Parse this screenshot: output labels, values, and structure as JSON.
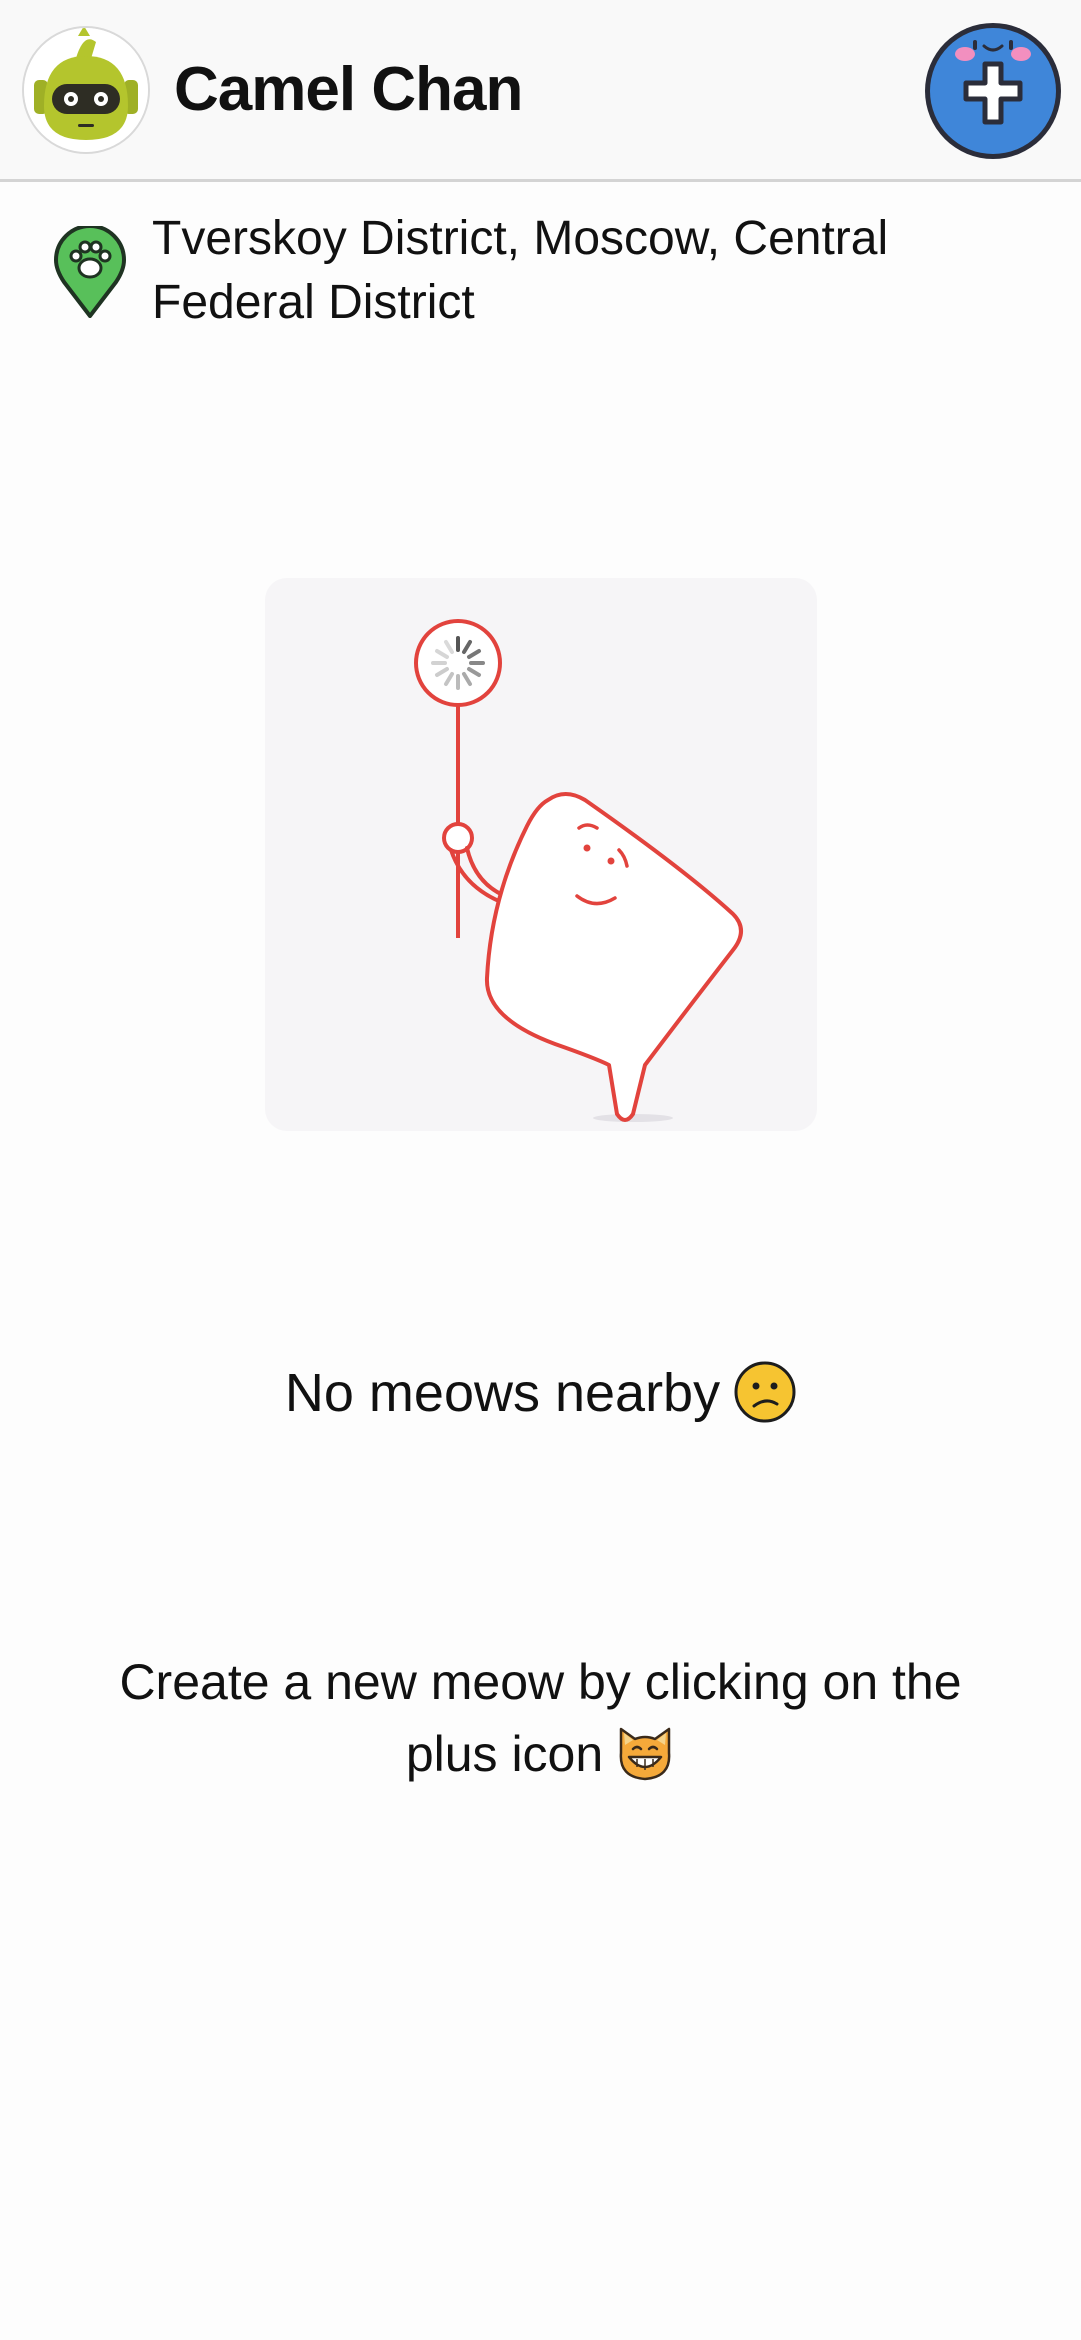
{
  "header": {
    "user_name": "Camel Chan",
    "avatar_icon": "robot-avatar-icon",
    "add_icon": "plus-icon"
  },
  "location": {
    "icon": "paw-location-pin-icon",
    "text": "Tverskoy District, Moscow, Central Federal District"
  },
  "empty_state": {
    "illustration": "loading-character-illustration",
    "title": "No meows nearby",
    "title_emoji": "confused-face-icon",
    "hint": "Create a new meow by clicking on the plus icon",
    "hint_emoji": "grinning-cat-icon"
  },
  "colors": {
    "accent_blue": "#3f86d9",
    "pin_green": "#58c05a",
    "illustration_red": "#e2433d",
    "avatar_green": "#b4c52d"
  }
}
